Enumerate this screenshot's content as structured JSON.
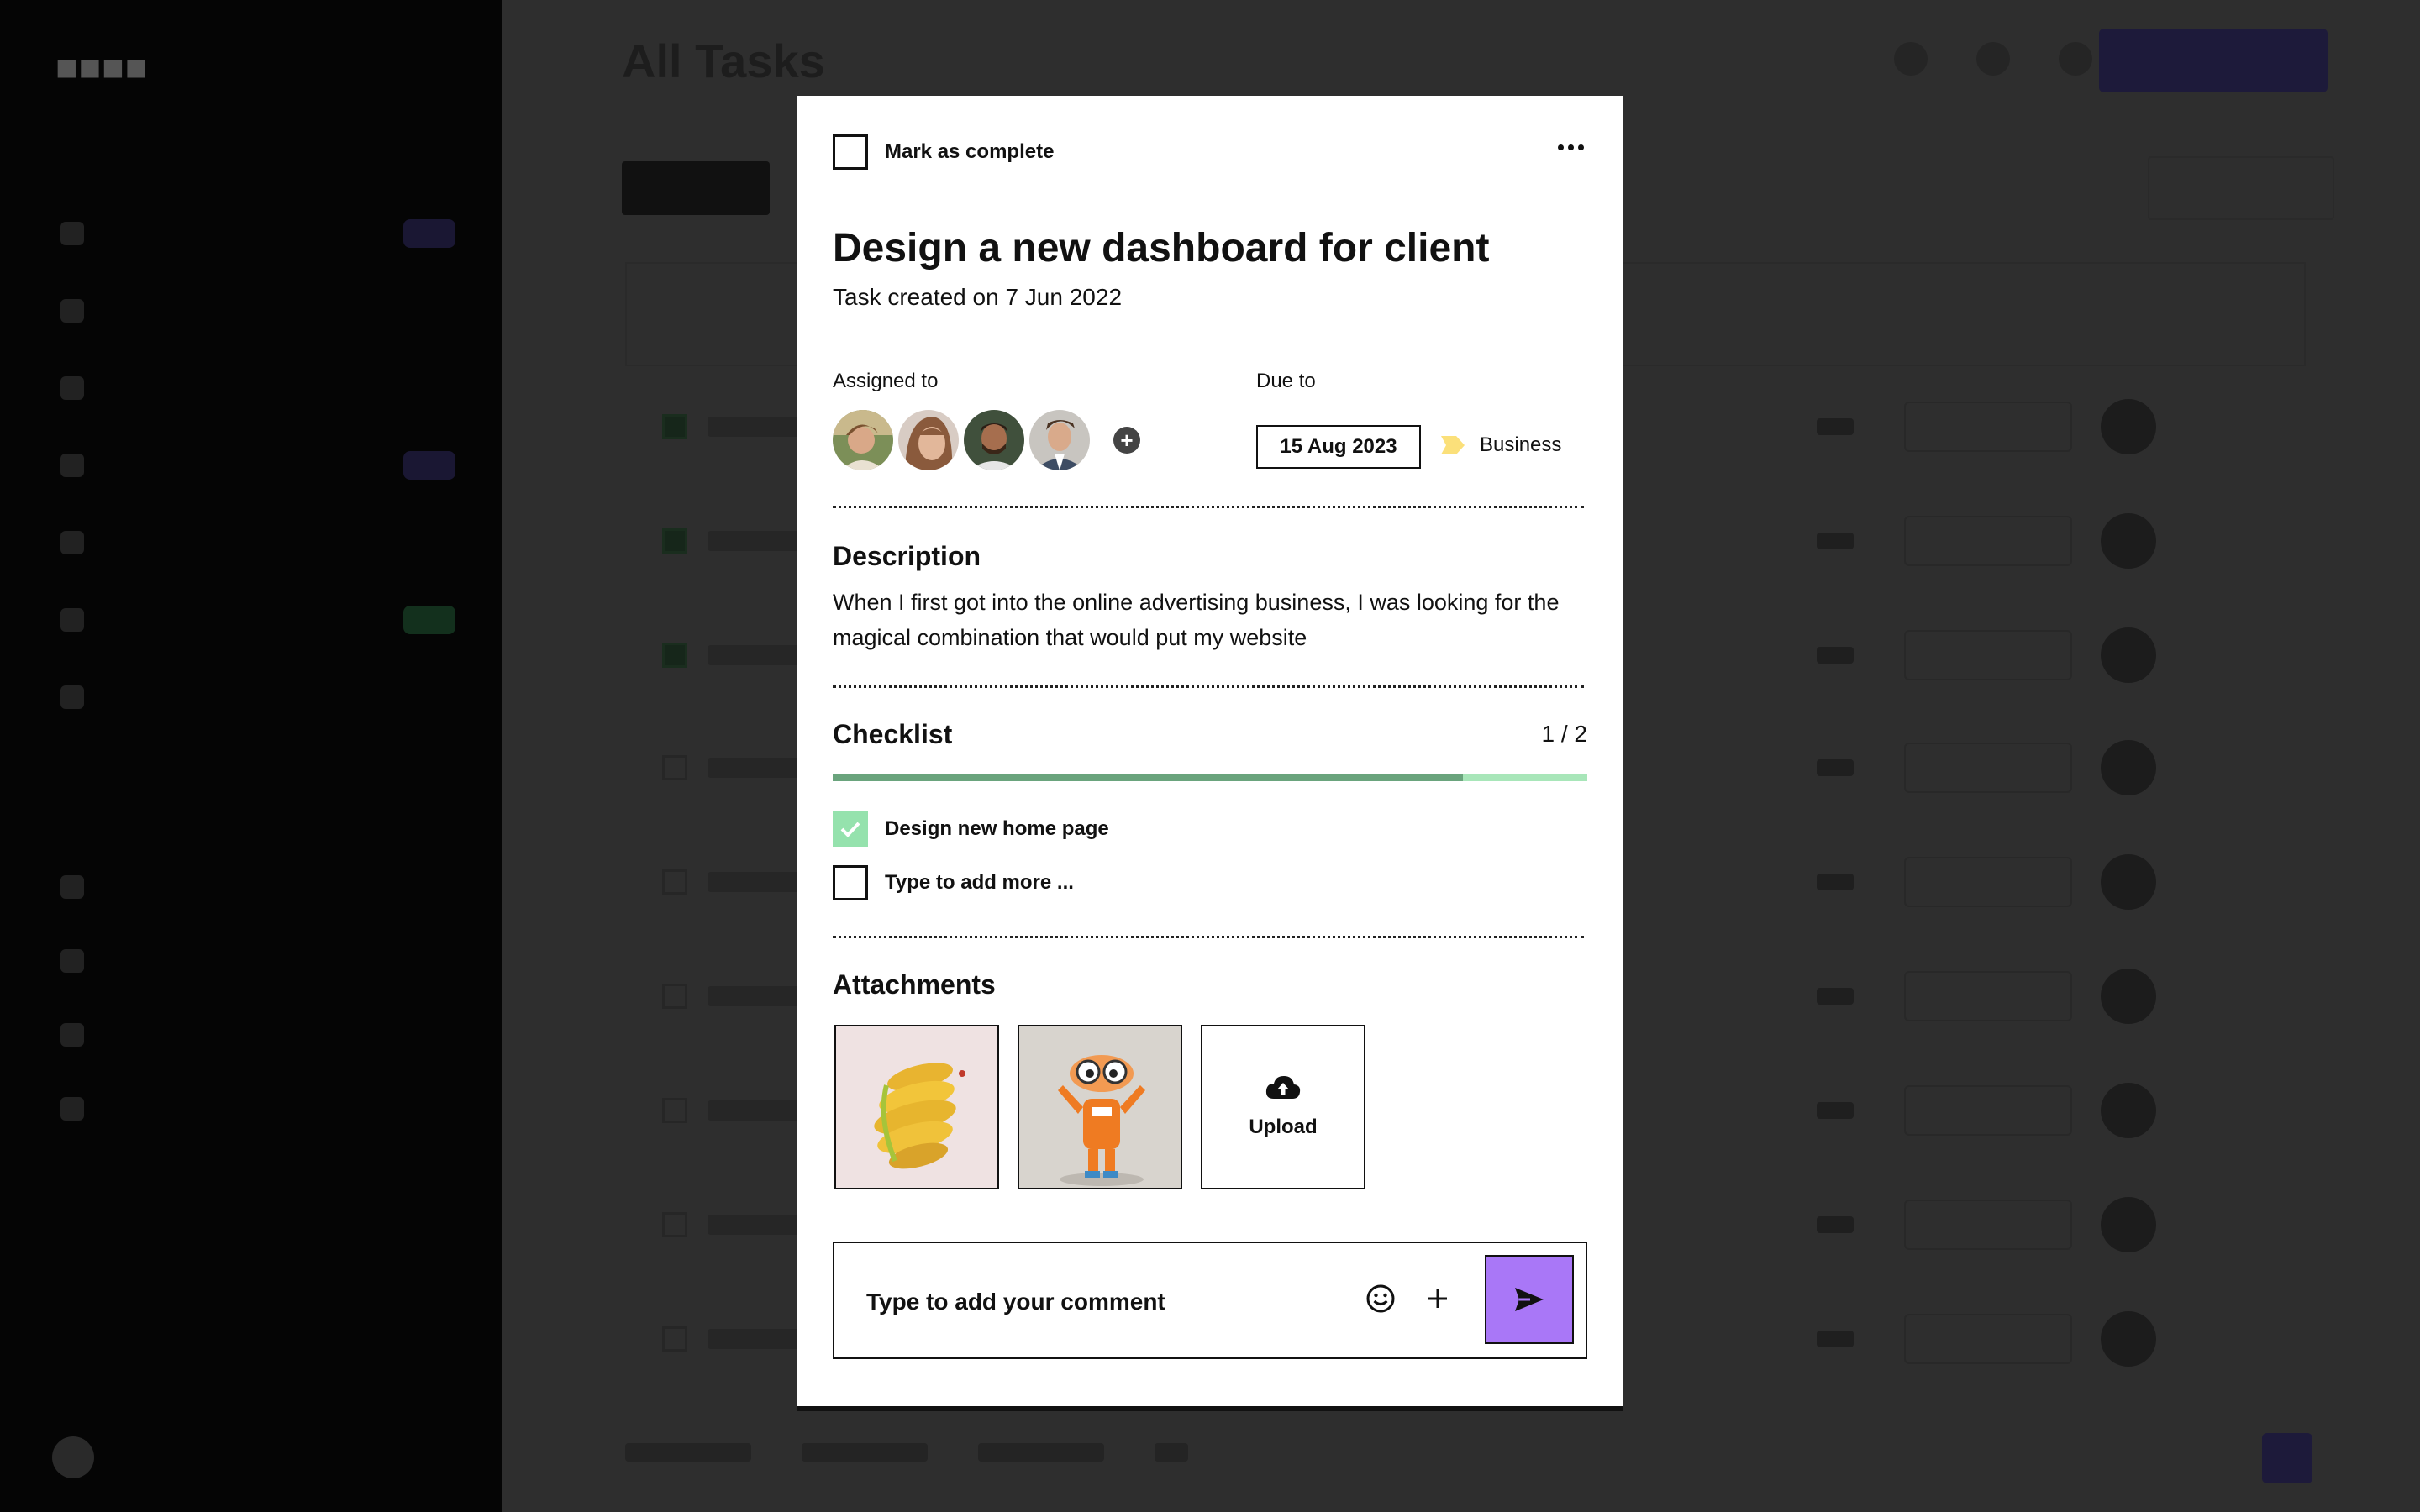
{
  "background": {
    "sidebar": {
      "logo": "",
      "items": [
        "",
        "",
        "",
        "",
        "",
        "",
        ""
      ]
    },
    "main": {
      "title": "All Tasks"
    }
  },
  "modal": {
    "mark_complete_label": "Mark as complete",
    "more_icon": "more-horizontal-icon",
    "title": "Design a new dashboard for client",
    "created": "Task created on 7 Jun 2022",
    "assigned_label": "Assigned to",
    "assignees": [
      {
        "name": "assignee-1"
      },
      {
        "name": "assignee-2"
      },
      {
        "name": "assignee-3"
      },
      {
        "name": "assignee-4"
      }
    ],
    "due_label": "Due to",
    "due_date": "15 Aug 2023",
    "tag": {
      "label": "Business",
      "color": "#fbe07a"
    },
    "description_title": "Description",
    "description_text": "When I first got into the online advertising business, I was looking for the magical combination that would put my website",
    "checklist_title": "Checklist",
    "checklist_count": "1 / 2",
    "checklist_progress": 0.835,
    "checklist_items": [
      {
        "label": "Design new home page",
        "checked": true
      },
      {
        "label": "Type to add more ...",
        "checked": false
      }
    ],
    "attachments_title": "Attachments",
    "upload_label": "Upload",
    "comment_placeholder": "Type to add your comment",
    "colors": {
      "accent": "#a977f7",
      "progress_fill": "#6aa47d",
      "progress_track": "#a8e6b9",
      "checked": "#95e2ad"
    }
  }
}
